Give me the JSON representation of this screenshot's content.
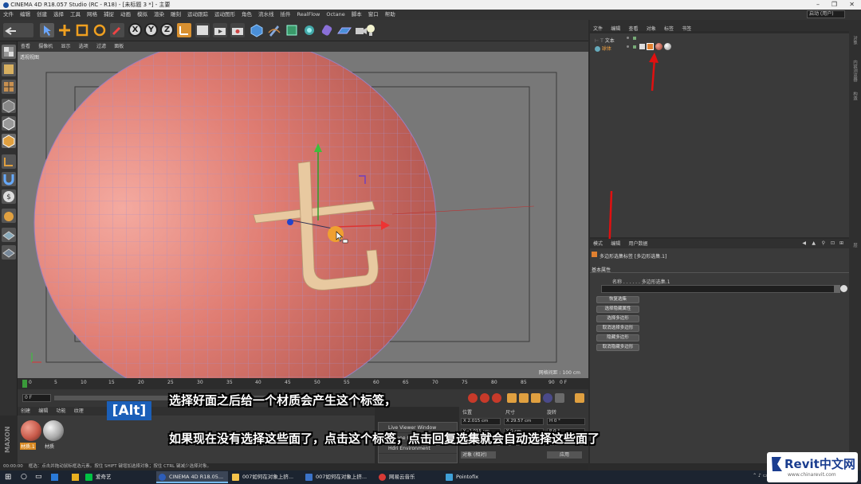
{
  "window": {
    "title": "CINEMA 4D R18.057 Studio (RC - R18) - [未标题 3 *] - 主要",
    "minimize": "–",
    "maximize": "❐",
    "close": "✕"
  },
  "menubar": [
    "文件",
    "编辑",
    "创建",
    "选择",
    "工具",
    "网格",
    "捕捉",
    "动画",
    "模拟",
    "渲染",
    "雕刻",
    "运动跟踪",
    "运动图形",
    "角色",
    "流水线",
    "插件",
    "RealFlow",
    "Octane",
    "脚本",
    "窗口",
    "帮助"
  ],
  "layout": {
    "label": "界面",
    "value": "启动 (用户)"
  },
  "toolbar": {
    "axis": [
      "X",
      "Y",
      "Z"
    ]
  },
  "viewport": {
    "menu": [
      "查看",
      "摄像机",
      "显示",
      "选项",
      "过滤",
      "面板"
    ],
    "label": "透视视图",
    "grid_label": "网格间距 : 100 cm"
  },
  "timeline": {
    "ticks": [
      "0",
      "5",
      "10",
      "15",
      "20",
      "25",
      "30",
      "35",
      "40",
      "45",
      "50",
      "55",
      "60",
      "65",
      "70",
      "75",
      "80",
      "85",
      "90"
    ],
    "end_frame": "0 F",
    "start_field": "0 F",
    "end_field": "90 F"
  },
  "material_manager": {
    "menu": [
      "创建",
      "编辑",
      "功能",
      "纹理"
    ],
    "materials": [
      {
        "label": "材质.1",
        "color": "#c85a4a"
      },
      {
        "label": "材质",
        "color": "#b8b8b8"
      }
    ],
    "brand": "MAXON CINEMA 4D"
  },
  "octane_menu": [
    "Live Viewer Window",
    "Octane Camera",
    "Hdri Environment"
  ],
  "coordinates": {
    "headers": [
      "位置",
      "尺寸",
      "旋转"
    ],
    "fields": [
      "X  2.015 cm",
      "X  29.57 cm",
      "H  0 °",
      "Y  -2.015 cm",
      "Y  0 cm",
      "P  0 °",
      "Z  0 cm",
      "Z  0 cm",
      "B  0 °"
    ],
    "mode": "对象 (相对)",
    "apply": "应用"
  },
  "status_bar": {
    "time": "00:00:00",
    "text": "框选：点击并拖动鼠标框选元素。按住 SHIFT 键增加选择对象；按住 CTRL 键减少选择对象。"
  },
  "object_manager": {
    "menu": [
      "文件",
      "编辑",
      "查看",
      "对象",
      "标签",
      "书签"
    ],
    "objects": [
      {
        "name": "文本"
      },
      {
        "name": "球体"
      }
    ]
  },
  "right_tabs": [
    "对象",
    "内容浏览器",
    "构造",
    "层"
  ],
  "attribute_manager": {
    "menu": [
      "模式",
      "编辑",
      "用户数据"
    ],
    "title": "多边形选集标签 [多边形选集.1]",
    "tab": "基本属性",
    "name_label": "名称 . . . . . . 多边形选集.1",
    "buttons": [
      "恢复选集",
      "选择隐藏属性",
      "选择多边形",
      "取消选择多边形",
      "隐藏多边形",
      "取消隐藏多边形"
    ]
  },
  "overlay": {
    "alt": "[Alt]",
    "caption1": "选择好面之后给一个材质会产生这个标签，",
    "caption2": "如果现在没有选择这些面了，点击这个标签，点击回复选集就会自动选择这些面了"
  },
  "taskbar": {
    "items": [
      {
        "label": "爱奇艺",
        "color": "#00c244"
      },
      {
        "label": "CINEMA 4D R18.05...",
        "color": "#2d5db8",
        "active": true
      },
      {
        "label": "007如何在对象上挤...",
        "color": "#f3c24b"
      },
      {
        "label": "007如何在对象上挤...",
        "color": "#3b73c8"
      },
      {
        "label": "网易云音乐",
        "color": "#d73a36"
      },
      {
        "label": "Pointofix",
        "color": "#3fa0d8"
      }
    ]
  },
  "watermark": {
    "brand": "Revit中文网",
    "url": "www.chinarevit.com"
  },
  "colors": {
    "sphere": "#dd7a70",
    "selection": "#e8c9a0",
    "accent": "#e03020"
  }
}
